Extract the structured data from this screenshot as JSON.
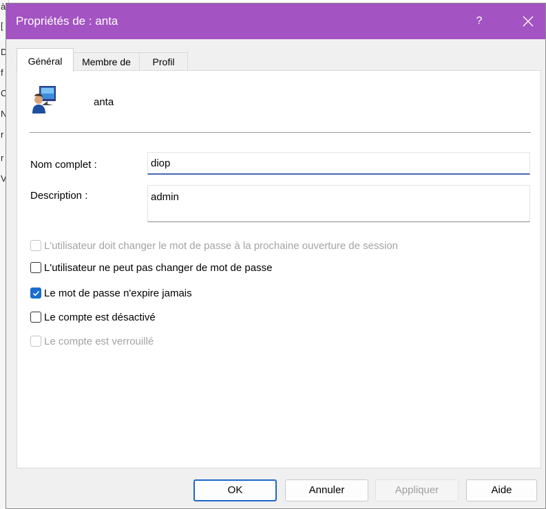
{
  "background_window": {
    "fragments": [
      "à",
      "[",
      "D",
      "f",
      "C",
      "N",
      "r",
      "r",
      "V"
    ]
  },
  "dialog": {
    "title": "Propriétés de : anta",
    "help_label": "?",
    "accent_color": "#a353c2"
  },
  "tabs": [
    {
      "label": "Général",
      "active": true
    },
    {
      "label": "Membre de",
      "active": false
    },
    {
      "label": "Profil",
      "active": false
    }
  ],
  "user": {
    "icon": "user-computer-icon",
    "name": "anta"
  },
  "fields": {
    "full_name_label": "Nom complet :",
    "full_name_value": "diop",
    "description_label": "Description :",
    "description_value": "admin"
  },
  "checkboxes": [
    {
      "label": "L'utilisateur doit changer le mot de passe à la prochaine ouverture de session",
      "checked": false,
      "enabled": false
    },
    {
      "label": "L'utilisateur ne peut pas changer de mot de passe",
      "checked": false,
      "enabled": true
    },
    {
      "label": "Le mot de passe n'expire jamais",
      "checked": true,
      "enabled": true
    },
    {
      "label": "Le compte est désactivé",
      "checked": false,
      "enabled": true
    },
    {
      "label": "Le compte est verrouillé",
      "checked": false,
      "enabled": false
    }
  ],
  "buttons": {
    "ok": "OK",
    "cancel": "Annuler",
    "apply": "Appliquer",
    "help": "Aide"
  }
}
